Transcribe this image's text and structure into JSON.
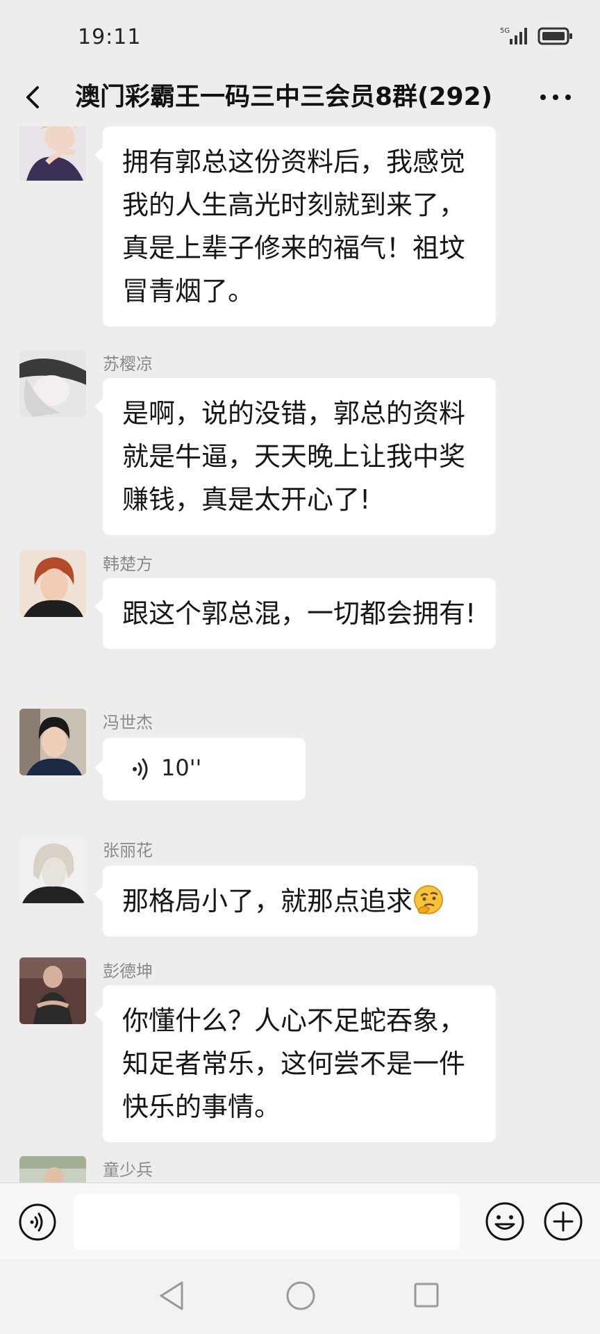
{
  "status_bar": {
    "time": "19:11",
    "network": "5G"
  },
  "header": {
    "title": "澳门彩霸王一码三中三会员8群(292)"
  },
  "messages": [
    {
      "sender": "",
      "avatar_icon": "avatar-photo",
      "text": "拥有郭总这份资料后，我感觉我的人生高光时刻就到来了，真是上辈子修来的福气！祖坟冒青烟了。"
    },
    {
      "sender": "苏樱凉",
      "avatar_icon": "avatar-photo",
      "text": "是啊，说的没错，郭总的资料就是牛逼，天天晚上让我中奖赚钱，真是太开心了!"
    },
    {
      "sender": "韩楚方",
      "avatar_icon": "avatar-photo",
      "text": "跟这个郭总混，一切都会拥有!"
    },
    {
      "sender": "冯世杰",
      "avatar_icon": "avatar-photo",
      "voice_duration": "10''"
    },
    {
      "sender": "张丽花",
      "avatar_icon": "avatar-photo",
      "text": "那格局小了，就那点追求",
      "emoji": "thinking-face"
    },
    {
      "sender": "彭德坤",
      "avatar_icon": "avatar-photo",
      "text": "你懂什么？人心不足蛇吞象，知足者常乐，这何尝不是一件快乐的事情。"
    },
    {
      "sender": "童少兵",
      "avatar_icon": "avatar-photo"
    }
  ],
  "input": {
    "value": "",
    "placeholder": ""
  },
  "colors": {
    "background": "#ededed",
    "bubble": "#ffffff",
    "sender_name": "#8a8a8a"
  }
}
